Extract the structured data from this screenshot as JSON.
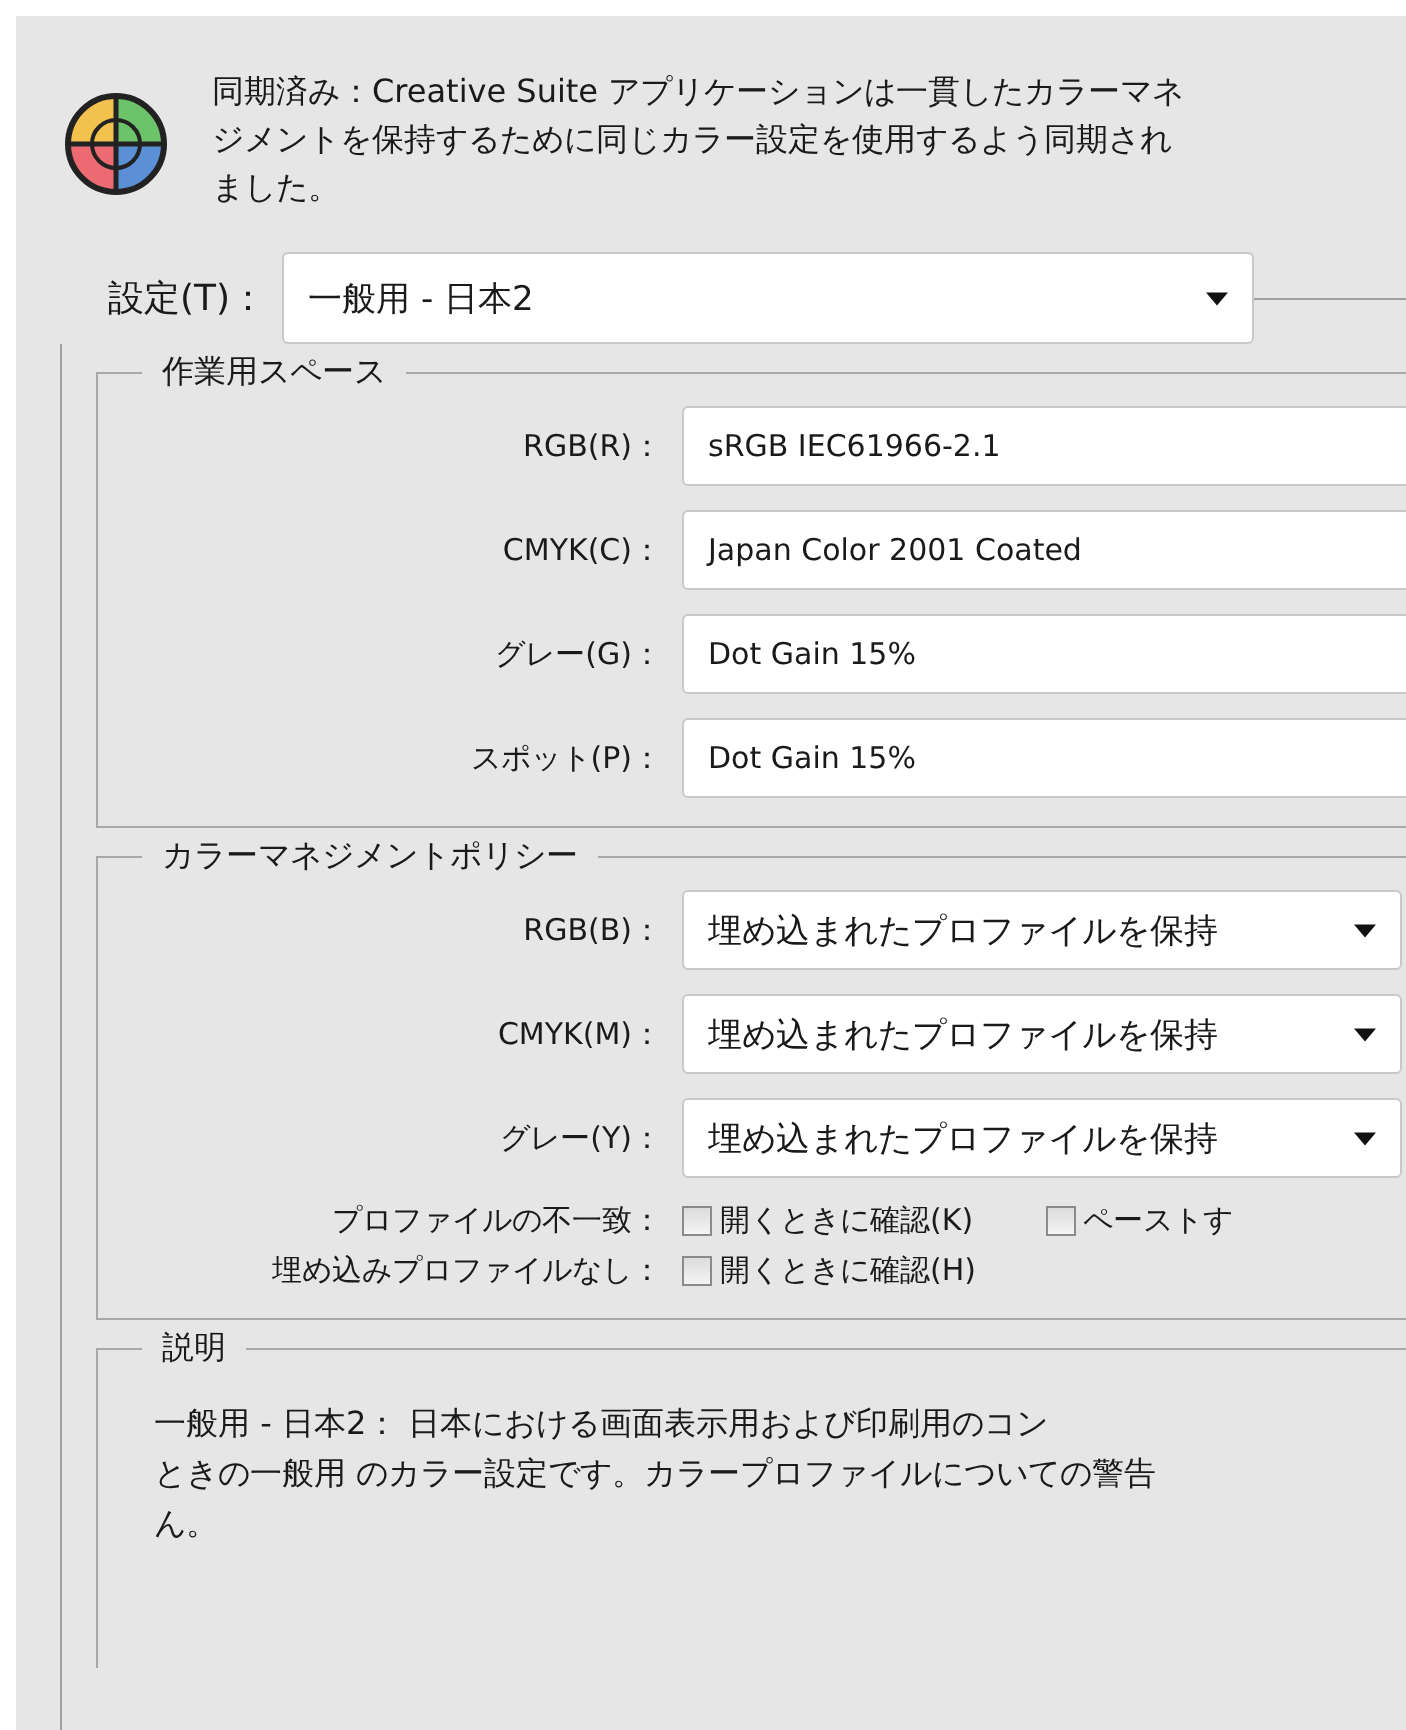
{
  "sync_notice": {
    "lines": [
      "同期済み：Creative Suite アプリケーションは一貫したカラーマネ",
      "ジメントを保持するために同じカラー設定を使用するよう同期され",
      "ました。"
    ]
  },
  "settings": {
    "label": "設定(T)：",
    "value": "一般用 - 日本2"
  },
  "working_spaces": {
    "title": "作業用スペース",
    "fields": [
      {
        "label": "RGB(R)：",
        "value": "sRGB IEC61966-2.1"
      },
      {
        "label": "CMYK(C)：",
        "value": "Japan Color 2001 Coated"
      },
      {
        "label": "グレー(G)：",
        "value": "Dot Gain 15%"
      },
      {
        "label": "スポット(P)：",
        "value": "Dot Gain 15%"
      }
    ]
  },
  "policies": {
    "title": "カラーマネジメントポリシー",
    "selects": [
      {
        "label": "RGB(B)：",
        "value": "埋め込まれたプロファイルを保持"
      },
      {
        "label": "CMYK(M)：",
        "value": "埋め込まれたプロファイルを保持"
      },
      {
        "label": "グレー(Y)：",
        "value": "埋め込まれたプロファイルを保持"
      }
    ],
    "options": [
      {
        "label": "プロファイルの不一致：",
        "checkboxes": [
          {
            "label": "開くときに確認(K)",
            "checked": false
          },
          {
            "label": "ペーストす",
            "checked": false
          }
        ]
      },
      {
        "label": "埋め込みプロファイルなし：",
        "checkboxes": [
          {
            "label": "開くときに確認(H)",
            "checked": false
          }
        ]
      }
    ]
  },
  "description": {
    "title": "説明",
    "lines": [
      "一般用 - 日本2： 日本における画面表示用および印刷用のコン",
      "ときの一般用 のカラー設定です。カラープロファイルについての警告",
      "ん。"
    ]
  }
}
